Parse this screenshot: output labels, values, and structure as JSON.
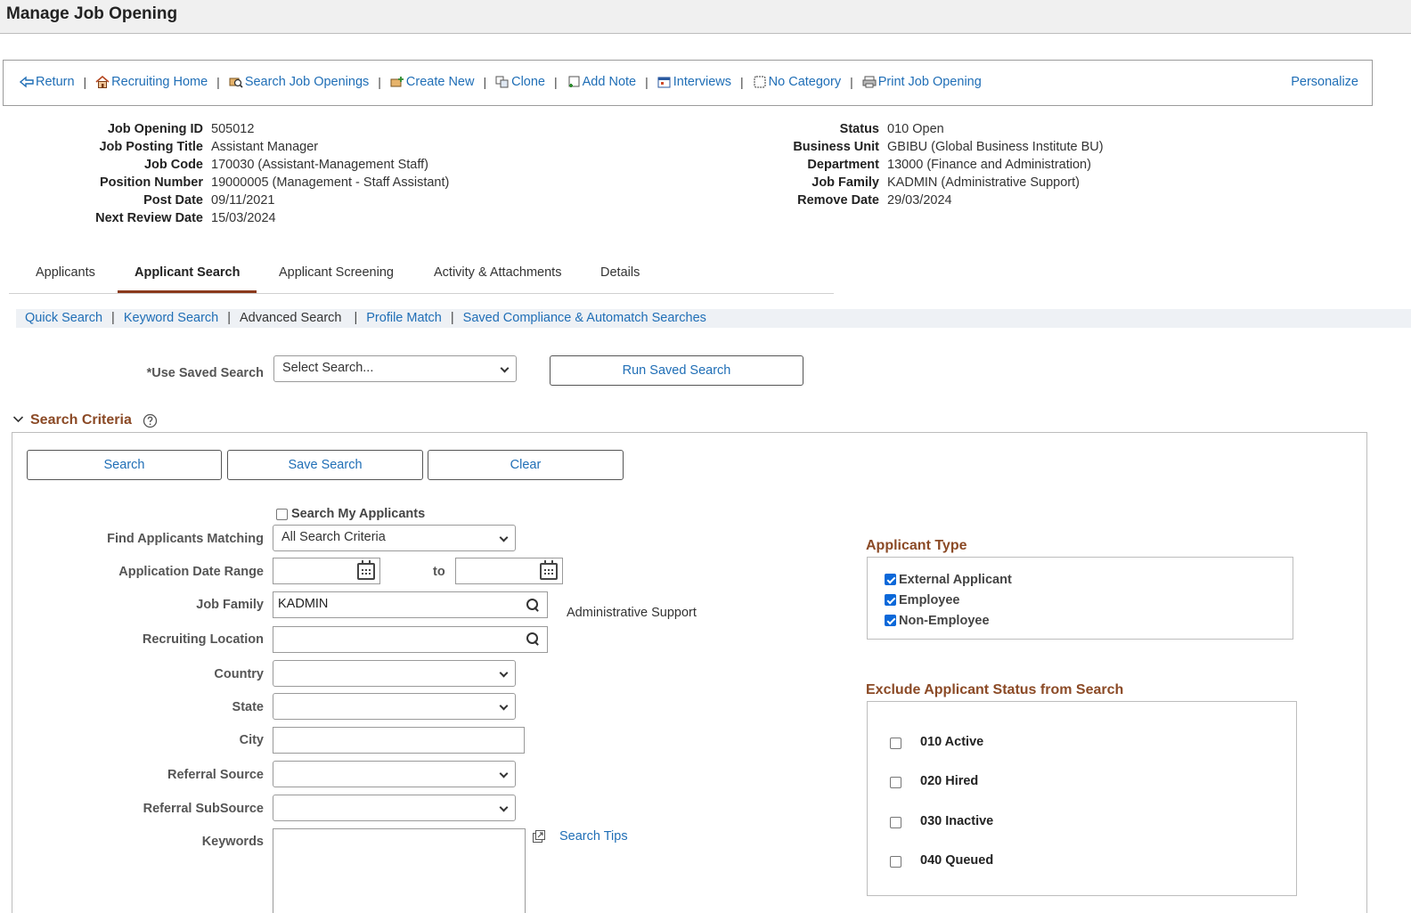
{
  "page_title": "Manage Job Opening",
  "toolbar": {
    "items": [
      {
        "label": "Return",
        "icon": "return-arrow-icon"
      },
      {
        "label": "Recruiting Home",
        "icon": "home-icon"
      },
      {
        "label": "Search Job Openings",
        "icon": "search-openings-icon"
      },
      {
        "label": "Create New",
        "icon": "create-new-icon"
      },
      {
        "label": "Clone",
        "icon": "clone-icon"
      },
      {
        "label": "Add Note",
        "icon": "add-note-icon"
      },
      {
        "label": "Interviews",
        "icon": "calendar-icon"
      },
      {
        "label": "No Category",
        "icon": "category-icon"
      },
      {
        "label": "Print Job Opening",
        "icon": "print-icon"
      }
    ],
    "separator": "|",
    "personalize": "Personalize"
  },
  "info_left": [
    {
      "label": "Job Opening ID",
      "value": "505012"
    },
    {
      "label": "Job Posting Title",
      "value": "Assistant Manager"
    },
    {
      "label": "Job Code",
      "value": "170030 (Assistant-Management Staff)"
    },
    {
      "label": "Position Number",
      "value": "19000005 (Management - Staff Assistant)"
    },
    {
      "label": "Post Date",
      "value": "09/11/2021"
    },
    {
      "label": "Next Review Date",
      "value": "15/03/2024"
    }
  ],
  "info_right": [
    {
      "label": "Status",
      "value": "010 Open"
    },
    {
      "label": "Business Unit",
      "value": "GBIBU (Global Business Institute BU)"
    },
    {
      "label": "Department",
      "value": "13000 (Finance and Administration)"
    },
    {
      "label": "Job Family",
      "value": "KADMIN (Administrative Support)"
    },
    {
      "label": "Remove Date",
      "value": "29/03/2024"
    }
  ],
  "tabs": [
    {
      "label": "Applicants",
      "active": false
    },
    {
      "label": "Applicant Search",
      "active": true
    },
    {
      "label": "Applicant Screening",
      "active": false
    },
    {
      "label": "Activity & Attachments",
      "active": false
    },
    {
      "label": "Details",
      "active": false
    }
  ],
  "subnav": {
    "quick": "Quick Search",
    "keyword": "Keyword Search",
    "advanced": "Advanced Search",
    "profile": "Profile Match",
    "saved": "Saved Compliance & Automatch Searches",
    "separator": "|"
  },
  "saved_search": {
    "label": "*Use Saved Search",
    "selected": "Select Search...",
    "run_button": "Run Saved Search"
  },
  "search_criteria": {
    "title": "Search Criteria",
    "buttons": {
      "search": "Search",
      "save": "Save Search",
      "clear": "Clear"
    },
    "search_my_applicants": "Search My Applicants",
    "find_matching": {
      "label": "Find Applicants Matching",
      "selected": "All Search Criteria"
    },
    "date_range": {
      "label": "Application Date Range",
      "to": "to"
    },
    "job_family": {
      "label": "Job Family",
      "value": "KADMIN",
      "description": "Administrative Support"
    },
    "recruiting_location": {
      "label": "Recruiting Location",
      "value": ""
    },
    "country": {
      "label": "Country",
      "value": ""
    },
    "state": {
      "label": "State",
      "value": ""
    },
    "city": {
      "label": "City",
      "value": ""
    },
    "referral_source": {
      "label": "Referral Source",
      "value": ""
    },
    "referral_subsource": {
      "label": "Referral SubSource",
      "value": ""
    },
    "keywords": {
      "label": "Keywords",
      "value": ""
    },
    "search_tips": "Search Tips"
  },
  "applicant_type": {
    "title": "Applicant Type",
    "items": [
      {
        "label": "External Applicant",
        "checked": true
      },
      {
        "label": "Employee",
        "checked": true
      },
      {
        "label": "Non-Employee",
        "checked": true
      }
    ]
  },
  "exclude_status": {
    "title": "Exclude Applicant Status from Search",
    "items": [
      {
        "label": "010 Active",
        "checked": false
      },
      {
        "label": "020 Hired",
        "checked": false
      },
      {
        "label": "030 Inactive",
        "checked": false
      },
      {
        "label": "040 Queued",
        "checked": false
      }
    ]
  },
  "colors": {
    "link": "#1f6eb6",
    "section_title": "#8b4a26",
    "active_tab_underline": "#8b3a1c",
    "checkbox": "#0b68d9"
  }
}
